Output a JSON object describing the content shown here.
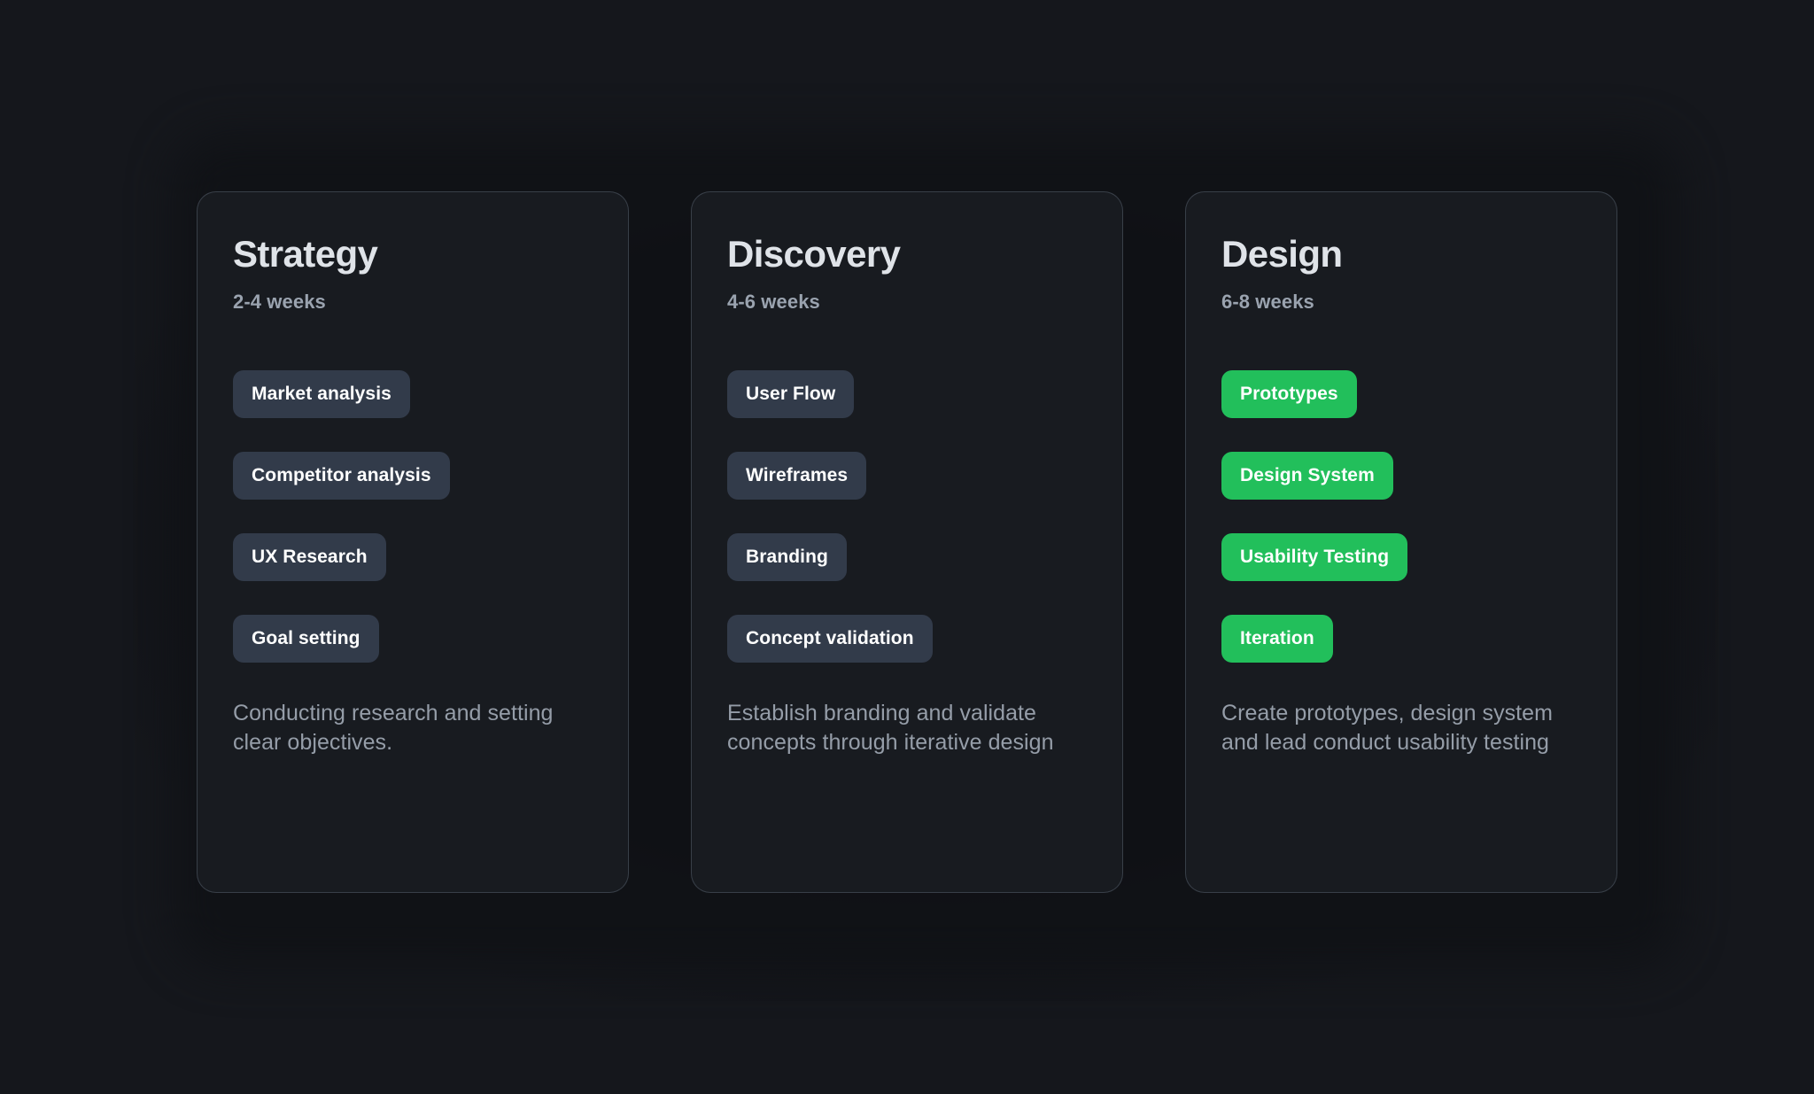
{
  "theme": {
    "page_background": "#15171c",
    "card_background": "#181b20",
    "card_border": "rgba(150,168,190,0.26)",
    "title_color": "#dfe3e8",
    "duration_color": "#9aa3af",
    "description_color": "#959da8",
    "tag_neutral_background": "#323b4a",
    "tag_accent_background": "#22bf5b",
    "tag_text_color": "#ffffff"
  },
  "cards": [
    {
      "title": "Strategy",
      "duration": "2-4 weeks",
      "tag_style": "neutral",
      "tags": [
        "Market analysis",
        "Competitor analysis",
        "UX Research",
        "Goal setting"
      ],
      "description": "Conducting research and setting clear objectives."
    },
    {
      "title": "Discovery",
      "duration": "4-6 weeks",
      "tag_style": "neutral",
      "tags": [
        "User Flow",
        "Wireframes",
        "Branding",
        "Concept validation"
      ],
      "description": "Establish branding and validate concepts through iterative design"
    },
    {
      "title": "Design",
      "duration": "6-8 weeks",
      "tag_style": "accent",
      "tags": [
        "Prototypes",
        "Design System",
        "Usability Testing",
        "Iteration"
      ],
      "description": "Create prototypes, design system and lead conduct usability testing"
    }
  ]
}
